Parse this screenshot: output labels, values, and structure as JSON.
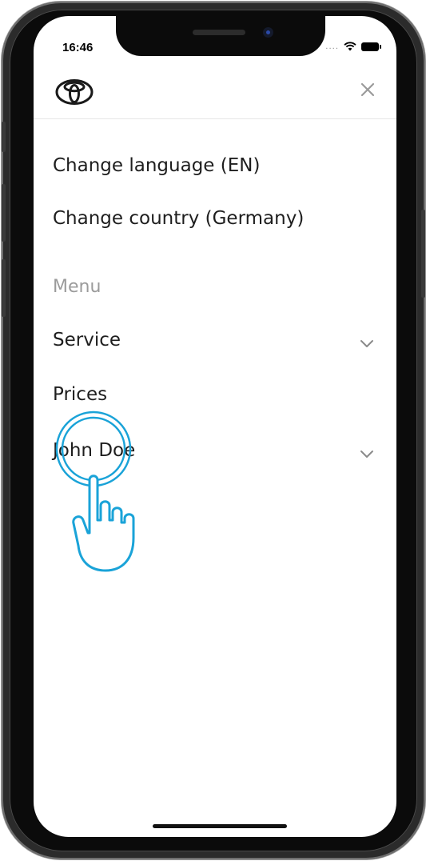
{
  "status_bar": {
    "time": "16:46",
    "signal": "...."
  },
  "header": {
    "brand_logo": "toyota-logo",
    "close_icon": "close-icon"
  },
  "settings": {
    "language_label": "Change language (EN)",
    "country_label": "Change country (Germany)"
  },
  "menu": {
    "heading": "Menu",
    "items": [
      {
        "label": "Service",
        "expandable": true
      },
      {
        "label": "Prices",
        "expandable": false
      },
      {
        "label": "John Doe",
        "expandable": true
      }
    ]
  },
  "overlay": {
    "icon": "tap-gesture-hand-icon",
    "color": "#1aa3d8"
  },
  "colors": {
    "text": "#1e1e1e",
    "muted": "#9b9b9b",
    "divider": "#e6e6e6"
  }
}
